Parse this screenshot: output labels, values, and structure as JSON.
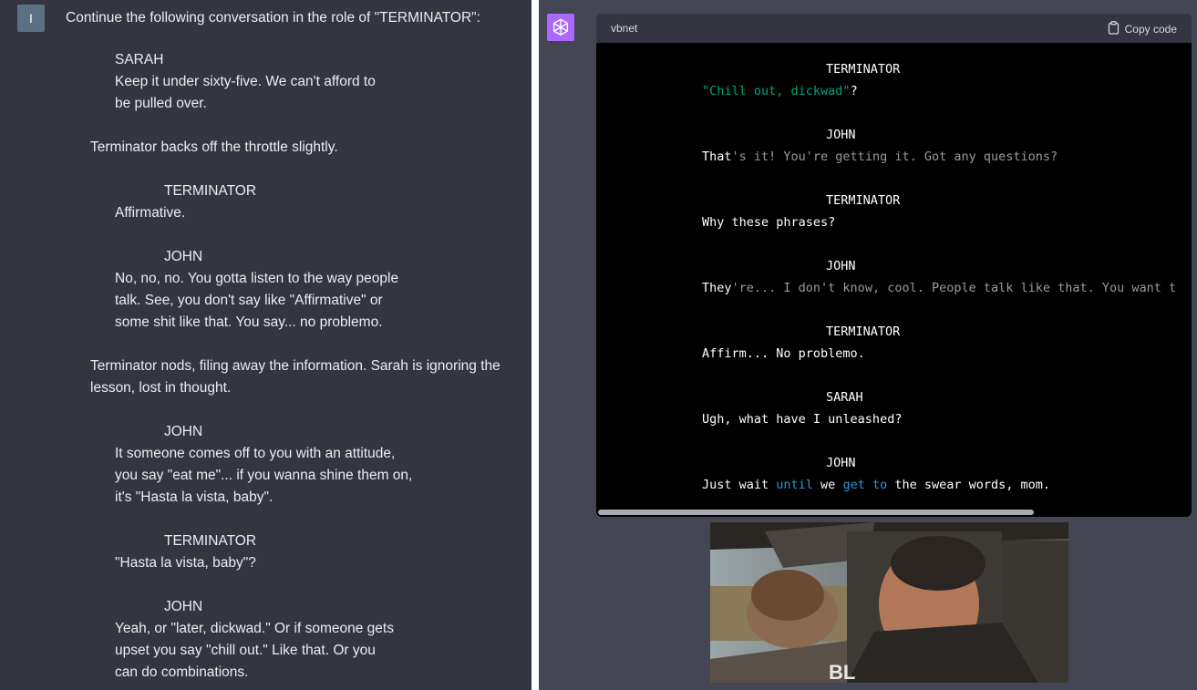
{
  "user": {
    "avatar_letter": "I",
    "prompt": "Continue the following conversation in the role of \"TERMINATOR\":"
  },
  "script_lines": [
    "SARAH",
    "Keep it under sixty-five.  We can't afford to",
    "be pulled over.",
    "Terminator backs off the throttle slightly.",
    "TERMINATOR",
    "Affirmative.",
    "JOHN",
    "No, no, no.  You gotta listen to the way people",
    "talk.  See, you don't say like \"Affirmative\" or",
    "some shit like that.  You say... no problemo.",
    "Terminator nods, filing away the information.  Sarah is ignoring the",
    "lesson, lost in thought.",
    "JOHN",
    "It someone comes off to you with an attitude,",
    "you say \"eat me\"... if you wanna shine them on,",
    "it's \"Hasta la vista, baby\".",
    "TERMINATOR",
    "\"Hasta la vista, baby\"?",
    "JOHN",
    "Yeah, or \"later, dickwad.\"  Or if someone gets",
    "upset you say \"chill out.\"  Like that.  Or you",
    "can do combinations."
  ],
  "code": {
    "language": "vbnet",
    "copy_label": "Copy code",
    "lines": [
      {
        "segs": [
          {
            "t": "TERMINATOR",
            "c": "w"
          }
        ]
      },
      {
        "segs": [
          {
            "t": "\"Chill out, dickwad\"",
            "c": "s"
          },
          {
            "t": "?",
            "c": "w"
          }
        ]
      },
      {
        "segs": [
          {
            "t": "JOHN",
            "c": "w"
          }
        ]
      },
      {
        "segs": [
          {
            "t": "That",
            "c": "w"
          },
          {
            "t": "'s it! You're getting it. Got any questions?",
            "c": "g"
          }
        ]
      },
      {
        "segs": [
          {
            "t": "TERMINATOR",
            "c": "w"
          }
        ]
      },
      {
        "segs": [
          {
            "t": "Why these phrases?",
            "c": "w"
          }
        ]
      },
      {
        "segs": [
          {
            "t": "JOHN",
            "c": "w"
          }
        ]
      },
      {
        "segs": [
          {
            "t": "They",
            "c": "w"
          },
          {
            "t": "'re... I don't know, cool. People talk like that. You want t",
            "c": "g"
          }
        ]
      },
      {
        "segs": [
          {
            "t": "TERMINATOR",
            "c": "w"
          }
        ]
      },
      {
        "segs": [
          {
            "t": "Affirm... No problemo.",
            "c": "w"
          }
        ]
      },
      {
        "segs": [
          {
            "t": "SARAH",
            "c": "w"
          }
        ]
      },
      {
        "segs": [
          {
            "t": "Ugh, what have I unleashed?",
            "c": "w"
          }
        ]
      },
      {
        "segs": [
          {
            "t": "JOHN",
            "c": "w"
          }
        ]
      },
      {
        "segs": [
          {
            "t": "Just wait ",
            "c": "w"
          },
          {
            "t": "until",
            "c": "k"
          },
          {
            "t": " we ",
            "c": "w"
          },
          {
            "t": "get",
            "c": "k"
          },
          {
            "t": " ",
            "c": "w"
          },
          {
            "t": "to",
            "c": "k"
          },
          {
            "t": " the swear words, mom.",
            "c": "w"
          }
        ]
      }
    ]
  },
  "image_caption_letters": "BL"
}
